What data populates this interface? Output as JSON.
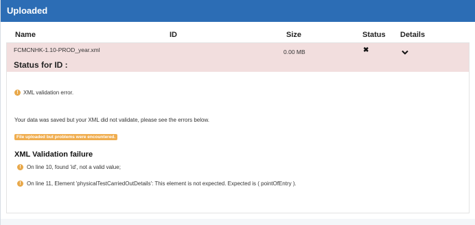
{
  "header": {
    "title": "Uploaded"
  },
  "table": {
    "columns": {
      "name": "Name",
      "id": "ID",
      "size": "Size",
      "status": "Status",
      "details": "Details"
    }
  },
  "file": {
    "name": "FCMCNHK-1.10-PROD_year.xml",
    "id": "",
    "size": "0.00 MB",
    "status_icon": "close-icon",
    "details_icon": "chevron-down-icon"
  },
  "status_panel": {
    "title": "Status for ID :",
    "xml_error": "XML validation error.",
    "saved_message": "Your data was saved but your XML did not validate, please see the errors below.",
    "badge": "File uploaded but problems were encountered.",
    "validation_title": "XML Validation failure",
    "errors": [
      "On line 10, found 'id', not a valid value;",
      "On line 11, Element 'physicalTestCarriedOutDetails': This element is not expected. Expected is ( pointOfEntry )."
    ]
  },
  "colors": {
    "header_bg": "#2c6db5",
    "row_error_bg": "#f2dede",
    "warning": "#e8a84a",
    "badge_bg": "#f0ad4e"
  }
}
